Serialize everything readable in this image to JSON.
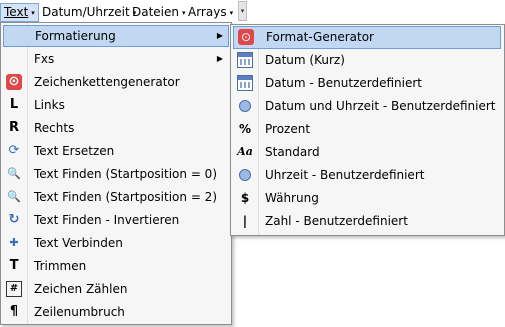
{
  "menubar": {
    "items": [
      {
        "label": "Text",
        "arrow": "▾"
      },
      {
        "label": "Datum/Uhrzeit",
        "arrow": "▾"
      },
      {
        "label": "Dateien",
        "arrow": "▾"
      },
      {
        "label": "Arrays",
        "arrow": "▾"
      }
    ],
    "overflow_glyph": "▾"
  },
  "text_menu": {
    "items": [
      {
        "label": "Formatierung",
        "icon": "none",
        "submenu_arrow": "▶"
      },
      {
        "label": "Fxs",
        "icon": "none",
        "submenu_arrow": "▶"
      },
      {
        "label": "Zeichenkettengenerator",
        "icon": "generator-icon",
        "glyph": "⊙"
      },
      {
        "label": "Links",
        "icon": "letter-l-icon",
        "glyph": "L"
      },
      {
        "label": "Rechts",
        "icon": "letter-r-icon",
        "glyph": "R"
      },
      {
        "label": "Text Ersetzen",
        "icon": "replace-icon",
        "glyph": "⟳"
      },
      {
        "label": "Text Finden (Startposition = 0)",
        "icon": "magnifier-icon",
        "glyph": "🔍"
      },
      {
        "label": "Text Finden (Startposition = 2)",
        "icon": "magnifier-icon",
        "glyph": "🔍"
      },
      {
        "label": "Text Finden - Invertieren",
        "icon": "invert-icon",
        "glyph": "↻"
      },
      {
        "label": "Text Verbinden",
        "icon": "plus-icon",
        "glyph": "✚"
      },
      {
        "label": "Trimmen",
        "icon": "letter-t-icon",
        "glyph": "T"
      },
      {
        "label": "Zeichen Zählen",
        "icon": "count-icon",
        "glyph": "#"
      },
      {
        "label": "Zeilenumbruch",
        "icon": "pilcrow-icon",
        "glyph": "¶"
      }
    ]
  },
  "format_submenu": {
    "items": [
      {
        "label": "Format-Generator",
        "icon": "generator-icon",
        "glyph": "⊙"
      },
      {
        "label": "Datum (Kurz)",
        "icon": "calendar-icon",
        "glyph": ""
      },
      {
        "label": "Datum - Benutzerdefiniert",
        "icon": "calendar-icon",
        "glyph": ""
      },
      {
        "label": "Datum und Uhrzeit - Benutzerdefiniert",
        "icon": "clock-icon",
        "glyph": ""
      },
      {
        "label": "Prozent",
        "icon": "percent-icon",
        "glyph": "%"
      },
      {
        "label": "Standard",
        "icon": "font-aa-icon",
        "glyph": "Aa"
      },
      {
        "label": "Uhrzeit - Benutzerdefiniert",
        "icon": "clock-icon",
        "glyph": ""
      },
      {
        "label": "Währung",
        "icon": "currency-icon",
        "glyph": "$"
      },
      {
        "label": "Zahl - Benutzerdefiniert",
        "icon": "number-icon",
        "glyph": "|"
      }
    ]
  },
  "colors": {
    "highlight": "#c2d8f2",
    "highlight_border": "#6a9fd8",
    "menu_bg": "#f6f6f6",
    "accent_red": "#e04848"
  }
}
